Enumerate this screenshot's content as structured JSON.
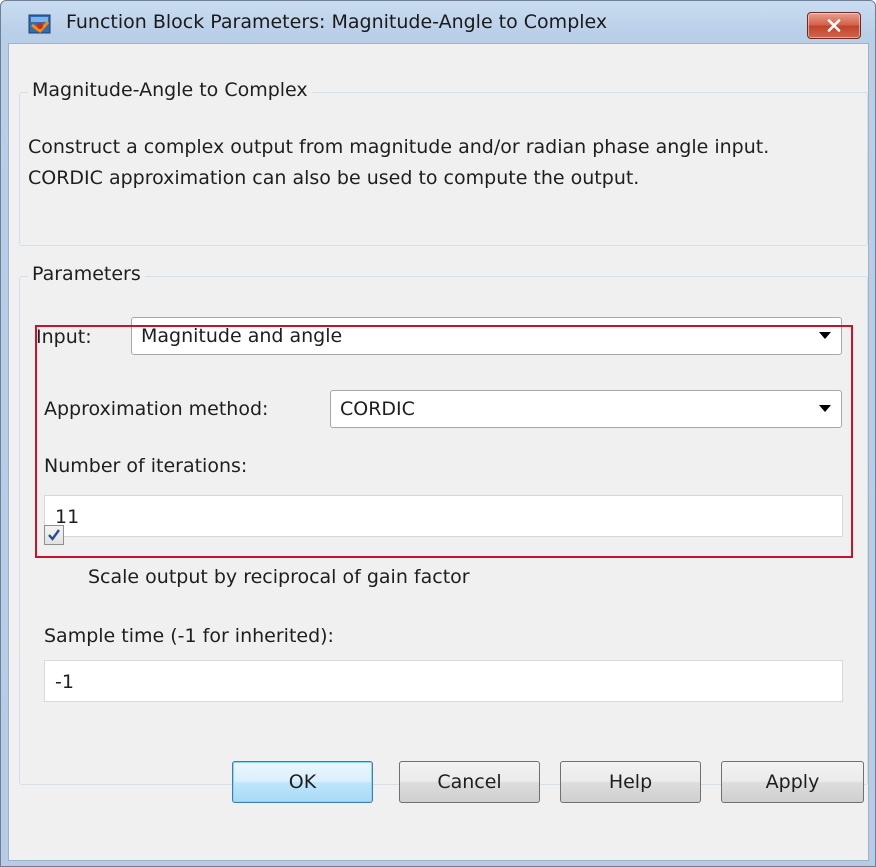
{
  "window": {
    "title": "Function Block Parameters: Magnitude-Angle to Complex",
    "icon": "simulink-block-icon",
    "close_icon": "close-icon"
  },
  "description_group": {
    "legend": "Magnitude-Angle to Complex",
    "text": "Construct a complex output from magnitude and/or radian phase angle input. CORDIC approximation can also be used to compute the output."
  },
  "parameters": {
    "legend": "Parameters",
    "input_label": "Input:",
    "input_value": "Magnitude and angle",
    "approx_label": "Approximation method:",
    "approx_value": "CORDIC",
    "iterations_label": "Number of iterations:",
    "iterations_value": "11",
    "scale_checkbox_label": "Scale output by reciprocal of gain factor",
    "scale_checked": true,
    "sample_time_label": "Sample time (-1 for inherited):",
    "sample_time_value": "-1"
  },
  "buttons": {
    "ok": "OK",
    "cancel": "Cancel",
    "help": "Help",
    "apply": "Apply"
  },
  "colors": {
    "highlight_border": "#c8142a",
    "close_button": "#c2432c",
    "default_button": "#bee6fd"
  }
}
